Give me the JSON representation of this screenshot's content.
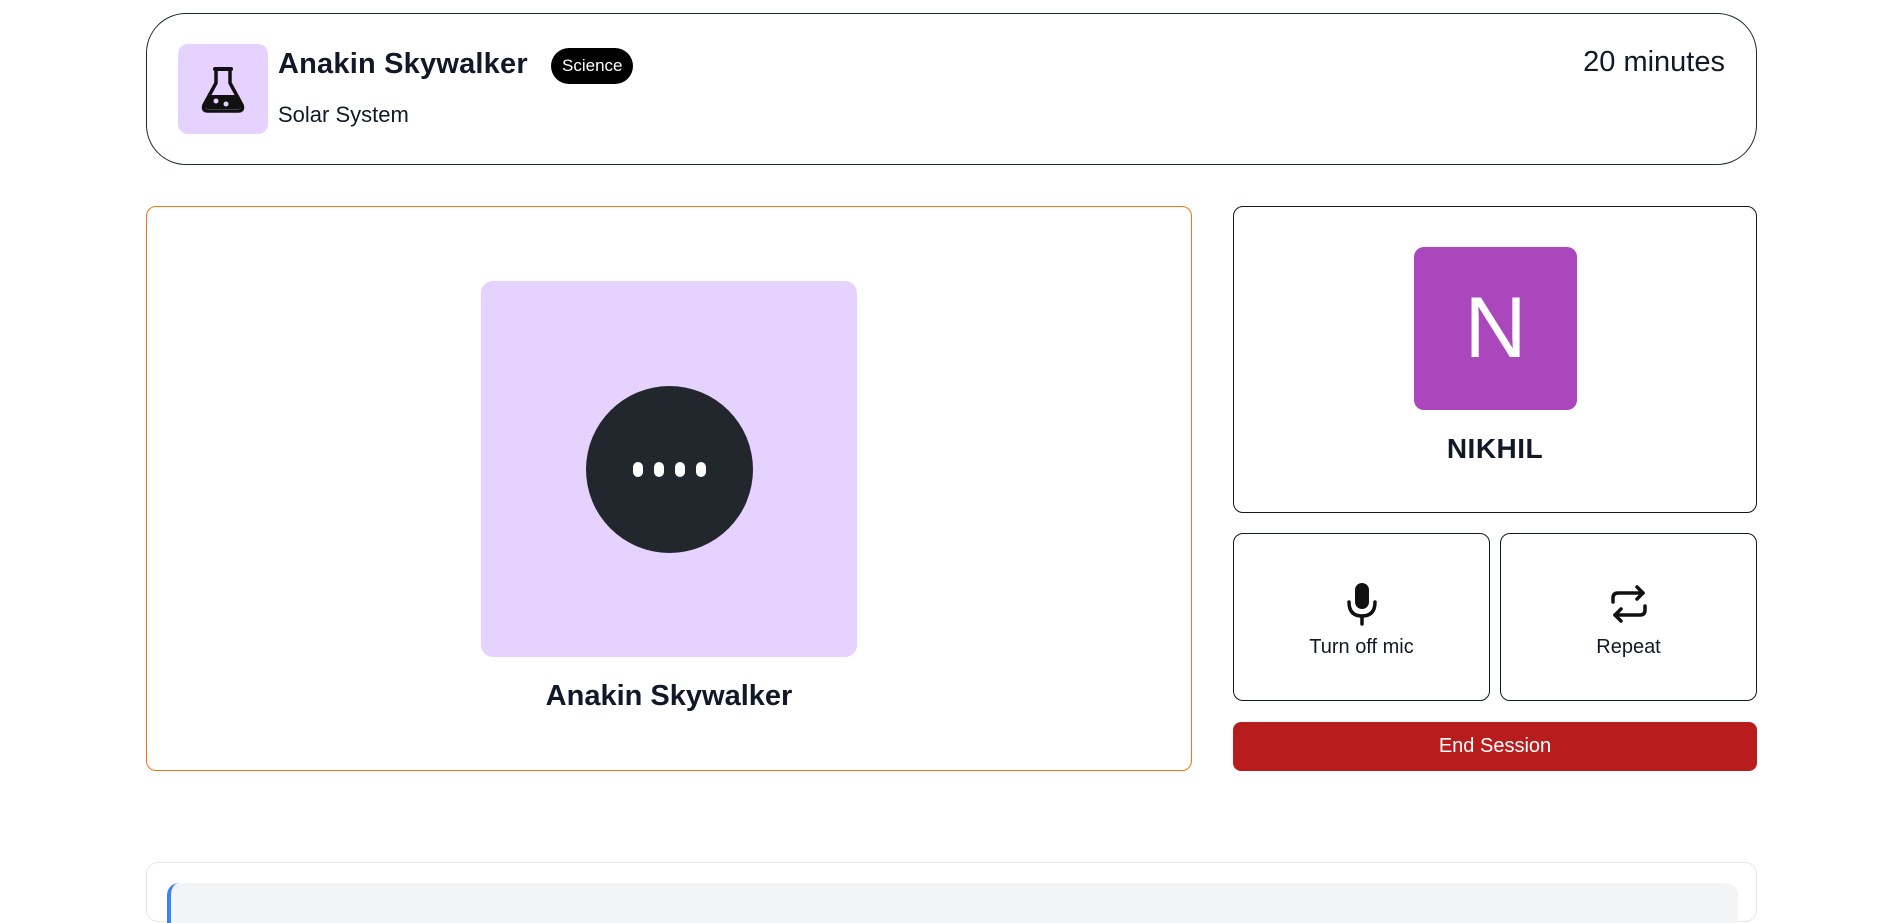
{
  "header": {
    "companion_name": "Anakin Skywalker",
    "subject_badge": "Science",
    "topic": "Solar System",
    "duration": "20 minutes",
    "subject_icon": "flask-icon"
  },
  "companion": {
    "name": "Anakin Skywalker",
    "avatar_bg": "#e6d2fe",
    "status_icon": "speaking-dots-icon"
  },
  "user": {
    "initial": "N",
    "name": "NIKHIL",
    "avatar_color": "#ab47bc"
  },
  "controls": {
    "mic_label": "Turn off mic",
    "mic_icon": "microphone-icon",
    "repeat_label": "Repeat",
    "repeat_icon": "repeat-icon",
    "end_label": "End Session"
  },
  "colors": {
    "accent_border": "#f97316",
    "danger": "#b91c1c",
    "transcript_accent": "#3b82f6"
  }
}
